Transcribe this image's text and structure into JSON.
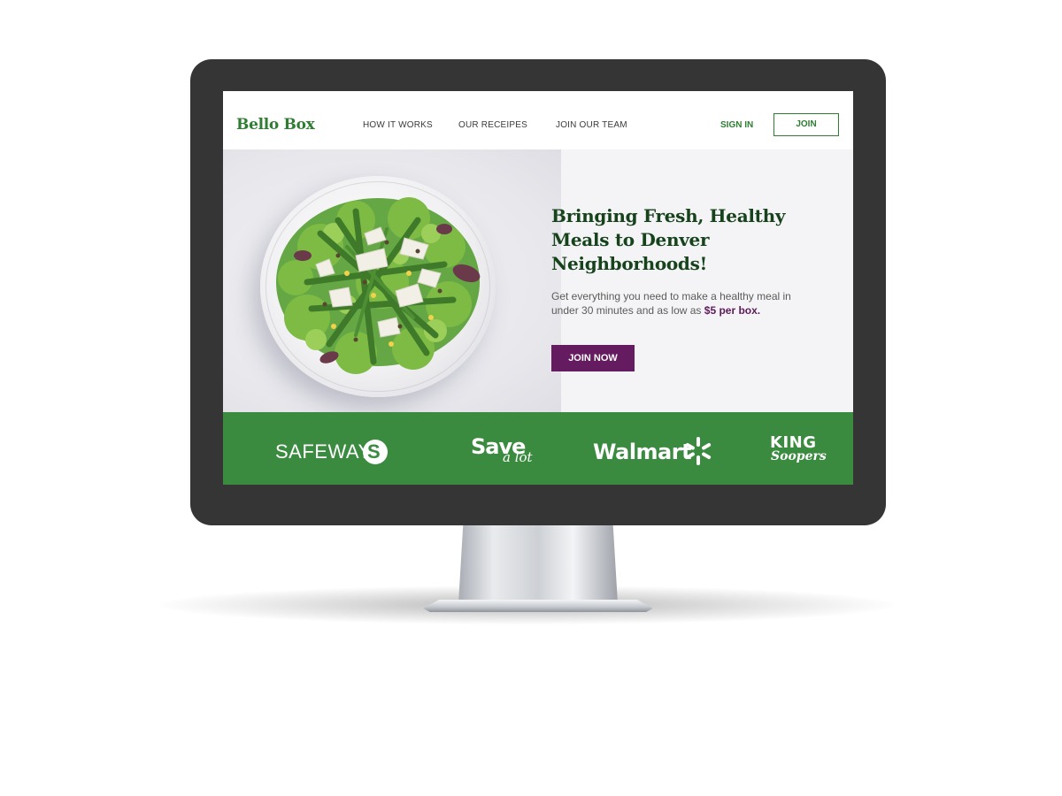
{
  "nav": {
    "logo": "Bello Box",
    "links": [
      "HOW IT WORKS",
      "OUR RECEIPES",
      "JOIN OUR TEAM"
    ],
    "sign_in": "SIGN IN",
    "join": "JOIN"
  },
  "hero": {
    "headline": "Bringing Fresh, Healthy Meals to Denver Neighborhoods!",
    "sub_text": "Get everything you need to make a healthy meal in under 30 minutes and as low as",
    "sub_price": "$5 per box.",
    "cta": "JOIN NOW",
    "image": "salad-plate-photo"
  },
  "partners": {
    "safeway": "SAFEWAY",
    "save_a_lot_main": "Save",
    "save_a_lot_sub": "a lot",
    "walmart": "Walmart",
    "king_soopers_main": "KING",
    "king_soopers_sub": "Soopers"
  },
  "colors": {
    "brand_green": "#2e7d32",
    "dark_green": "#17431c",
    "band_green": "#3a8a3f",
    "cta_purple": "#641b5f",
    "bezel": "#353535"
  }
}
